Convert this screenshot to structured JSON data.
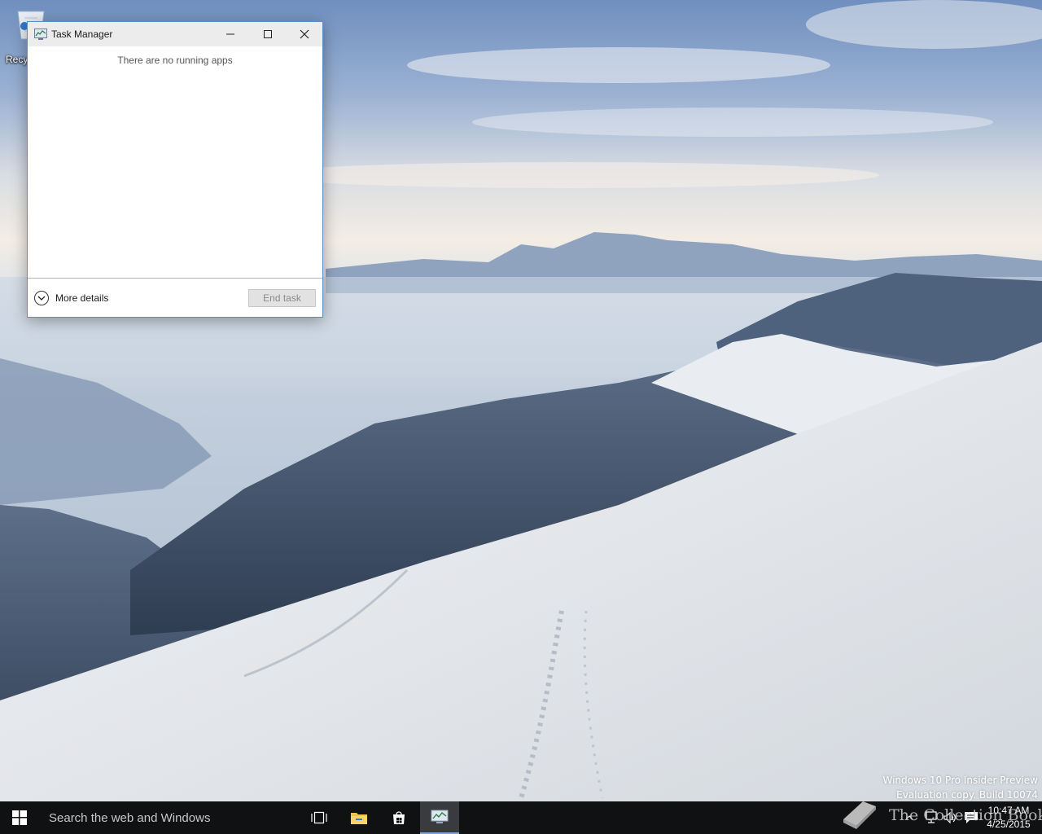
{
  "desktop": {
    "recycle_bin_label": "Recy",
    "watermark": {
      "line1": "Windows 10 Pro Insider Preview",
      "line2": "Evaluation copy. Build 10074"
    }
  },
  "window": {
    "title": "Task Manager",
    "icon": "task-manager-icon",
    "message": "There are no running apps",
    "more_details_label": "More details",
    "end_task_label": "End task",
    "end_task_enabled": false
  },
  "taskbar": {
    "search_placeholder": "Search the web and Windows",
    "buttons": [
      "task-view-icon",
      "file-explorer-icon",
      "store-icon",
      "task-manager-icon"
    ],
    "active_app": "Task Manager",
    "clock_time": "10:47 AM",
    "clock_date": "4/25/2015",
    "tray_icons": [
      "chevron-up-icon",
      "network-icon",
      "volume-icon",
      "action-center-icon"
    ],
    "brand_watermark": "The Collection Book"
  },
  "colors": {
    "taskbar": "#101113",
    "window_border": "#5b8dc9",
    "accent": "#7aa7d8"
  }
}
